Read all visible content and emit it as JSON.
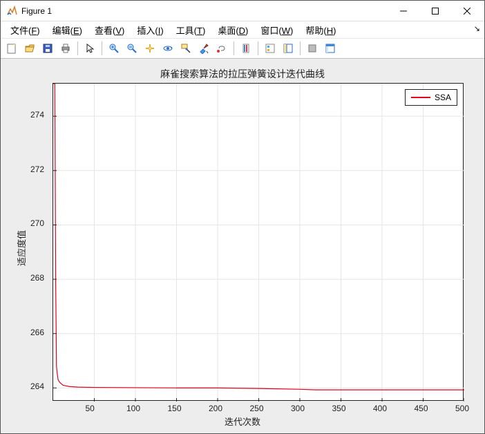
{
  "window": {
    "title": "Figure 1"
  },
  "menu": {
    "items": [
      {
        "label": "文件",
        "mn": "F"
      },
      {
        "label": "编辑",
        "mn": "E"
      },
      {
        "label": "查看",
        "mn": "V"
      },
      {
        "label": "插入",
        "mn": "I"
      },
      {
        "label": "工具",
        "mn": "T"
      },
      {
        "label": "桌面",
        "mn": "D"
      },
      {
        "label": "窗口",
        "mn": "W"
      },
      {
        "label": "帮助",
        "mn": "H"
      }
    ]
  },
  "toolbar": {
    "icons": [
      "new-figure-icon",
      "open-icon",
      "save-icon",
      "print-icon",
      "sep",
      "pointer-icon",
      "sep",
      "zoom-in-icon",
      "zoom-out-icon",
      "pan-icon",
      "rotate-3d-icon",
      "data-cursor-icon",
      "brush-icon",
      "link-icon",
      "sep",
      "colorbar-icon",
      "sep",
      "legend-icon",
      "insert-colorbar-icon",
      "sep",
      "hide-plot-tools-icon",
      "show-plot-tools-icon"
    ]
  },
  "chart_data": {
    "type": "line",
    "title": "麻雀搜索算法的拉压弹簧设计迭代曲线",
    "xlabel": "迭代次数",
    "ylabel": "适应度值",
    "xlim": [
      0,
      500
    ],
    "ylim": [
      263.5,
      275.2
    ],
    "xticks": [
      50,
      100,
      150,
      200,
      250,
      300,
      350,
      400,
      450,
      500
    ],
    "yticks": [
      264,
      266,
      268,
      270,
      272,
      274
    ],
    "grid": true,
    "legend": {
      "entries": [
        "SSA"
      ],
      "position": "northeast"
    },
    "series": [
      {
        "name": "SSA",
        "color": "#e2001a",
        "x": [
          0,
          1,
          2,
          3,
          4,
          5,
          6,
          8,
          10,
          12,
          15,
          20,
          30,
          50,
          100,
          150,
          200,
          250,
          300,
          320,
          350,
          400,
          450,
          500
        ],
        "y": [
          275.2,
          275.2,
          275.2,
          268.0,
          264.8,
          264.5,
          264.3,
          264.2,
          264.15,
          264.1,
          264.08,
          264.05,
          264.03,
          264.02,
          264.01,
          264.0,
          264.0,
          263.98,
          263.95,
          263.93,
          263.93,
          263.93,
          263.93,
          263.93
        ]
      }
    ]
  }
}
